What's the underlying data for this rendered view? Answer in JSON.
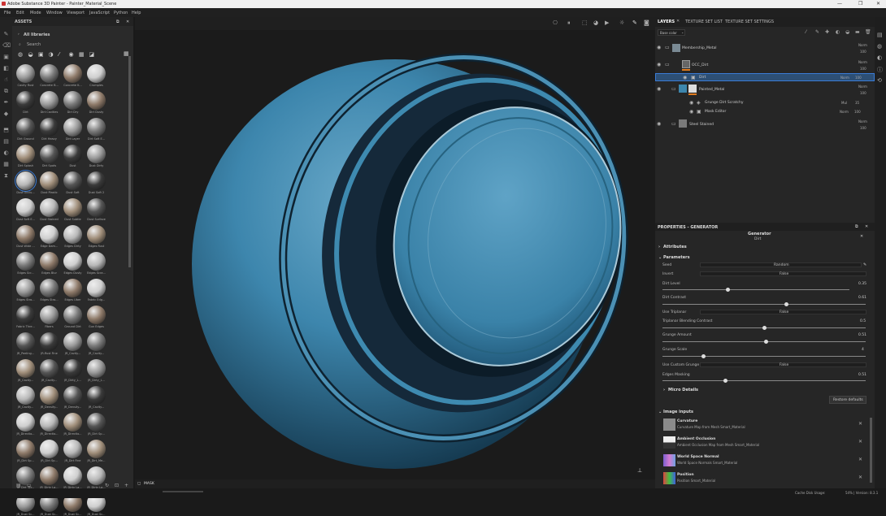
{
  "window": {
    "title": "Adobe Substance 3D Painter - Painter_Material_Scene",
    "minimize": "—",
    "maximize": "❐",
    "close": "✕"
  },
  "menu": [
    "File",
    "Edit",
    "Mode",
    "Window",
    "Viewport",
    "JavaScript",
    "Python",
    "Help"
  ],
  "assets": {
    "title": "ASSETS",
    "library": "All libraries",
    "search_placeholder": "Search",
    "items": [
      "Cavity Rust",
      "Concrete B...",
      "Concrete K...",
      "Crumples",
      "Dirt",
      "Dirt Cavities",
      "Dirt Dry",
      "Dirt Dusty",
      "Dirt Ground",
      "Dirt Heavy",
      "Dirt Layer",
      "Dirt Soft E...",
      "Dirt Splash",
      "Dirt Spots",
      "Dust",
      "Dust Dirty",
      "Dust Occlu...",
      "Dust Plastic",
      "Dust Soft",
      "Dust Soft 2",
      "Dust Soft E...",
      "Dust Stained",
      "Dust Subtle",
      "Dust Surface",
      "Dust Wide ...",
      "Edge Dam...",
      "Edges Dirty",
      "Edges Rust",
      "Edges Scr...",
      "Edges Blur",
      "Edges Dusty",
      "Edges Scra...",
      "Edges Stro...",
      "Edges Stro...",
      "Edges Uber",
      "Fabric Edg...",
      "Fabric Thre...",
      "Fibers",
      "Ground Dirt",
      "Gun Edges",
      "JR_Peeling...",
      "JR-Rust Fine",
      "JR_Cavity...",
      "JR_Cavity...",
      "JR_Cavity...",
      "JR_Cavity...",
      "JR_Dirty_L...",
      "JR_Dirty_L...",
      "JR_Cavity...",
      "JR_Density...",
      "JR_Density...",
      "JR_Cavity...",
      "JR_Directio...",
      "JR_Directio...",
      "JR_Directio...",
      "JR_Dirt Sp...",
      "JR_Dirt Sp...",
      "JR_Dirt Sp...",
      "JR_Dirt Fine",
      "JR_Dirt_Me...",
      "JR_Dirt_Str...",
      "JR_Dirty La...",
      "JR_Dirty La...",
      "JR_Dirty La...",
      "JR_Dust Sc...",
      "JR_Dust Sc...",
      "JR_Dust Sc...",
      "JR_Dust Sc..."
    ]
  },
  "viewport": {
    "profile": "Profile: ACES_UE4_Log",
    "mode": "Material",
    "mask_label": "MASK"
  },
  "tabs": {
    "layers": "LAYERS",
    "tsl": "TEXTURE SET LIST",
    "tss": "TEXTURE SET SETTINGS"
  },
  "layers": {
    "channel": "Base color",
    "items": [
      {
        "name": "Membership_Metal",
        "blend": "Norm",
        "opacity": "100"
      },
      {
        "name": "OCC_Dirt",
        "blend": "Norm",
        "opacity": "100"
      },
      {
        "name": "Dirt",
        "blend": "Norm",
        "opacity": "100"
      },
      {
        "name": "Painted_Metal",
        "blend": "Norm",
        "opacity": "100"
      },
      {
        "name": "Grunge Dirt Scratchy",
        "blend": "Mul",
        "opacity": "35"
      },
      {
        "name": "Mask Editor",
        "blend": "Norm",
        "opacity": "100"
      },
      {
        "name": "Steel Stained",
        "blend": "Norm",
        "opacity": "100"
      }
    ]
  },
  "properties": {
    "title": "PROPERTIES - GENERATOR",
    "gen_title": "Generator",
    "gen_sub": "Dirt",
    "attributes": "Attributes",
    "parameters": "Parameters",
    "seed_label": "Seed",
    "seed_val": "Random",
    "invert_label": "Invert",
    "invert_val": "False",
    "dirt_level_label": "Dirt Level",
    "dirt_level": "0.35",
    "dirt_contrast_label": "Dirt Contrast",
    "dirt_contrast": "0.61",
    "use_triplanar_label": "Use Triplanar",
    "use_triplanar": "False",
    "tri_blend_label": "Triplanar Blending Contrast",
    "tri_blend": "0.5",
    "grunge_amount_label": "Grunge Amount",
    "grunge_amount": "0.51",
    "grunge_scale_label": "Grunge Scale",
    "grunge_scale": "4",
    "use_custom_grunge_label": "Use Custom Grunge",
    "use_custom_grunge": "False",
    "edges_masking_label": "Edges Masking",
    "edges_masking": "0.51",
    "micro": "Micro Details",
    "restore": "Restore defaults",
    "image_inputs": "Image inputs",
    "inputs": [
      {
        "title": "Curvature",
        "desc": "Curvature Map from Mesh Smart_Material"
      },
      {
        "title": "Ambient Occlusion",
        "desc": "Ambient Occlusion Map from Mesh Smart_Material"
      },
      {
        "title": "World Space Normal",
        "desc": "World Space Normals Smart_Material"
      },
      {
        "title": "Position",
        "desc": "Position Smart_Material"
      }
    ]
  },
  "slider_levels": {
    "dirt_level": 0.35,
    "dirt_contrast": 0.61,
    "tri_blend": 0.5,
    "grunge_amount": 0.51,
    "grunge_scale": 0.2,
    "edges_masking": 0.31
  },
  "status": {
    "cache": "Cache Disk Usage:",
    "usage": "54% | Version: 8.3.1"
  },
  "colors": {
    "accent": "#3a7bd5",
    "sphere": "#3d86ad",
    "select": "#2d4f75",
    "orange": "#e07b1f"
  }
}
